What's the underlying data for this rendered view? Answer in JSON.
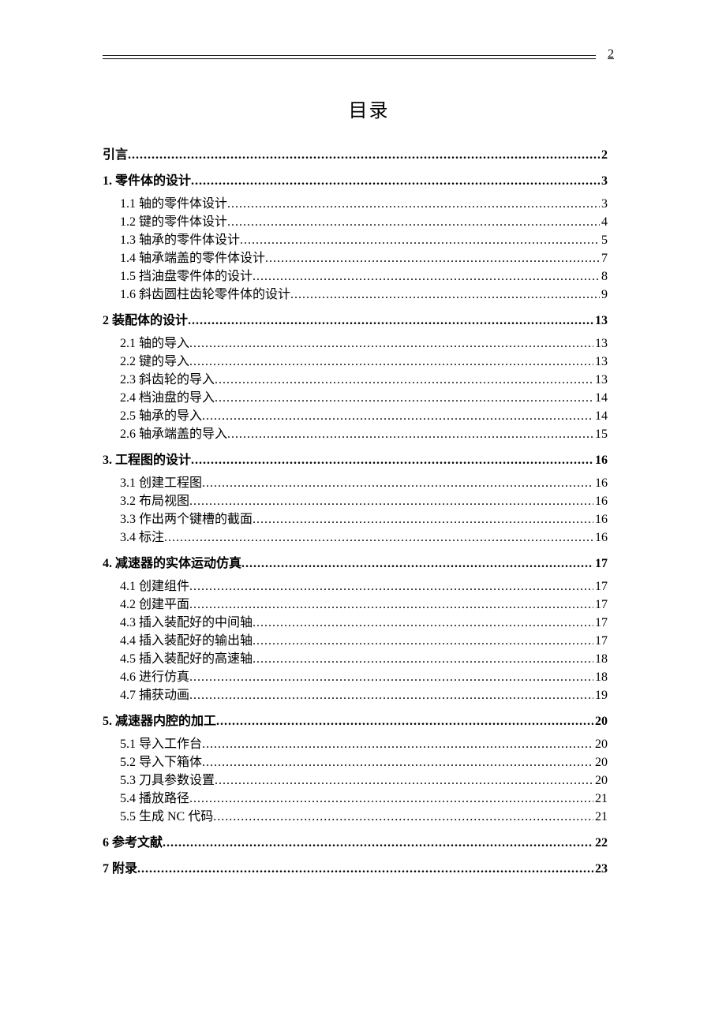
{
  "page_number": "2",
  "title": "目录",
  "toc": [
    {
      "level": 1,
      "label": "引言",
      "page": "2",
      "children": []
    },
    {
      "level": 1,
      "label": "1. 零件体的设计",
      "page": "3",
      "children": [
        {
          "label": "1.1 轴的零件体设计",
          "page": "3"
        },
        {
          "label": "1.2 键的零件体设计",
          "page": "4"
        },
        {
          "label": "1.3 轴承的零件体设计",
          "page": "5"
        },
        {
          "label": "1.4 轴承端盖的零件体设计",
          "page": "7"
        },
        {
          "label": "1.5 挡油盘零件体的设计",
          "page": "8"
        },
        {
          "label": "1.6 斜齿圆柱齿轮零件体的设计",
          "page": "9"
        }
      ]
    },
    {
      "level": 1,
      "label": "2 装配体的设计",
      "page": "13",
      "children": [
        {
          "label": "2.1 轴的导入",
          "page": "13"
        },
        {
          "label": "2.2 键的导入",
          "page": "13"
        },
        {
          "label": "2.3 斜齿轮的导入",
          "page": "13"
        },
        {
          "label": "2.4 档油盘的导入",
          "page": "14"
        },
        {
          "label": "2.5 轴承的导入",
          "page": "14"
        },
        {
          "label": "2.6 轴承端盖的导入",
          "page": "15"
        }
      ]
    },
    {
      "level": 1,
      "label": "3. 工程图的设计",
      "page": "16",
      "children": [
        {
          "label": "3.1 创建工程图",
          "page": "16"
        },
        {
          "label": "3.2 布局视图",
          "page": "16"
        },
        {
          "label": "3.3 作出两个键槽的截面",
          "page": "16"
        },
        {
          "label": "3.4 标注",
          "page": "16"
        }
      ]
    },
    {
      "level": 1,
      "label": "4. 减速器的实体运动仿真",
      "page": "17",
      "children": [
        {
          "label": "4.1 创建组件",
          "page": "17"
        },
        {
          "label": "4.2 创建平面",
          "page": "17"
        },
        {
          "label": "4.3 插入装配好的中间轴",
          "page": "17"
        },
        {
          "label": "4.4 插入装配好的输出轴",
          "page": "17"
        },
        {
          "label": "4.5 插入装配好的高速轴",
          "page": "18"
        },
        {
          "label": "4.6 进行仿真",
          "page": "18"
        },
        {
          "label": "4.7 捕获动画",
          "page": "19"
        }
      ]
    },
    {
      "level": 1,
      "label": "5. 减速器内腔的加工",
      "page": "20",
      "children": [
        {
          "label": "5.1 导入工作台",
          "page": "20"
        },
        {
          "label": "5.2 导入下箱体",
          "page": "20"
        },
        {
          "label": "5.3 刀具参数设置",
          "page": "20"
        },
        {
          "label": "5.4 播放路径",
          "page": "21"
        },
        {
          "label": "5.5 生成 NC 代码",
          "page": "21"
        }
      ]
    },
    {
      "level": 1,
      "label": "6 参考文献",
      "page": "22",
      "children": []
    },
    {
      "level": 1,
      "label": "7 附录",
      "page": "23",
      "children": []
    }
  ]
}
